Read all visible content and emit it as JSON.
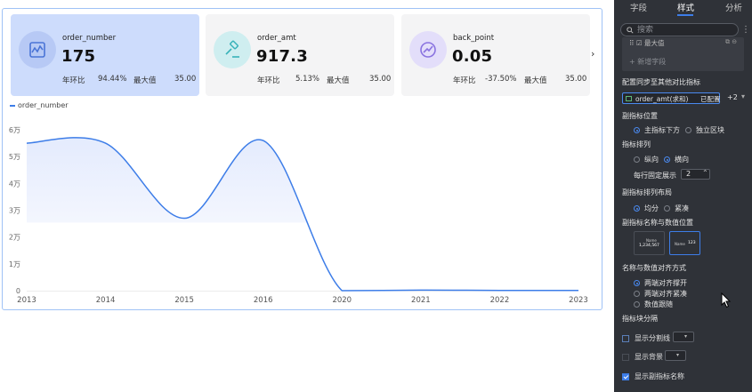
{
  "kpis": [
    {
      "name": "order_number",
      "value": "175",
      "yoy_label": "年环比",
      "yoy_value": "94.44%",
      "max_label": "最大值",
      "max_value": "35.00",
      "icon": "chart-icon",
      "icon_bg": "#b7c9f5",
      "icon_color": "#4a74d6"
    },
    {
      "name": "order_amt",
      "value": "917.3",
      "yoy_label": "年环比",
      "yoy_value": "5.13%",
      "max_label": "最大值",
      "max_value": "35.00",
      "icon": "hammer-icon",
      "icon_bg": "#cfeef0",
      "icon_color": "#38b2b9"
    },
    {
      "name": "back_point",
      "value": "0.05",
      "yoy_label": "年环比",
      "yoy_value": "-37.50%",
      "max_label": "最大值",
      "max_value": "35.00",
      "icon": "trend-icon",
      "icon_bg": "#e3defa",
      "icon_color": "#8a73e0"
    }
  ],
  "kpi_next": "›",
  "chart_data": {
    "type": "area",
    "legend": "order_number",
    "x": [
      "2013",
      "2014",
      "2015",
      "2016",
      "2020",
      "2021",
      "2022",
      "2023"
    ],
    "series": [
      {
        "name": "order_number",
        "values": [
          55000,
          55000,
          27000,
          56000,
          0,
          200,
          100,
          100
        ]
      }
    ],
    "y_ticks": [
      "0",
      "1万",
      "2万",
      "3万",
      "4万",
      "5万",
      "6万"
    ],
    "ylim": [
      0,
      60000
    ],
    "color": "#3d7de8",
    "grid": false
  },
  "panel": {
    "tabs": [
      "字段",
      "样式",
      "分析"
    ],
    "active_tab": 1,
    "search_placeholder": "搜索",
    "more_icon": "⋮",
    "field_row": "⠿ ☑ 最大值",
    "field_row_icons": "⧉ ⊖",
    "add_field": "+ 新增字段",
    "compare_label": "配置同步至其他对比指标",
    "compare_field": "order_amt(求和)",
    "compare_status": "已配置",
    "compare_more": "+2",
    "sub_position_label": "副指标位置",
    "sub_position_options": [
      "主指标下方",
      "独立区块"
    ],
    "arrange_label": "指标排列",
    "arrange_options": [
      "纵向",
      "横向"
    ],
    "per_row_label": "每行固定展示",
    "per_row_value": "2",
    "per_row_stepper": "⌃",
    "sub_layout_label": "副指标排列布局",
    "sub_layout_options": [
      "均分",
      "紧凑"
    ],
    "name_pos_label": "副指标名称与数值位置",
    "name_pos_thumbs": [
      {
        "name": "Name",
        "value": "1,234,567"
      },
      {
        "name": "Name",
        "value": "123"
      }
    ],
    "align_label": "名称与数值对齐方式",
    "align_options": [
      "两端对齐撑开",
      "两端对齐紧凑",
      "数值跟随"
    ],
    "divider_section_label": "指标块分隔",
    "show_divider": "显示分割线",
    "show_background": "显示背景",
    "show_sub_name": "显示副指标名称",
    "select_caret": "▾"
  }
}
